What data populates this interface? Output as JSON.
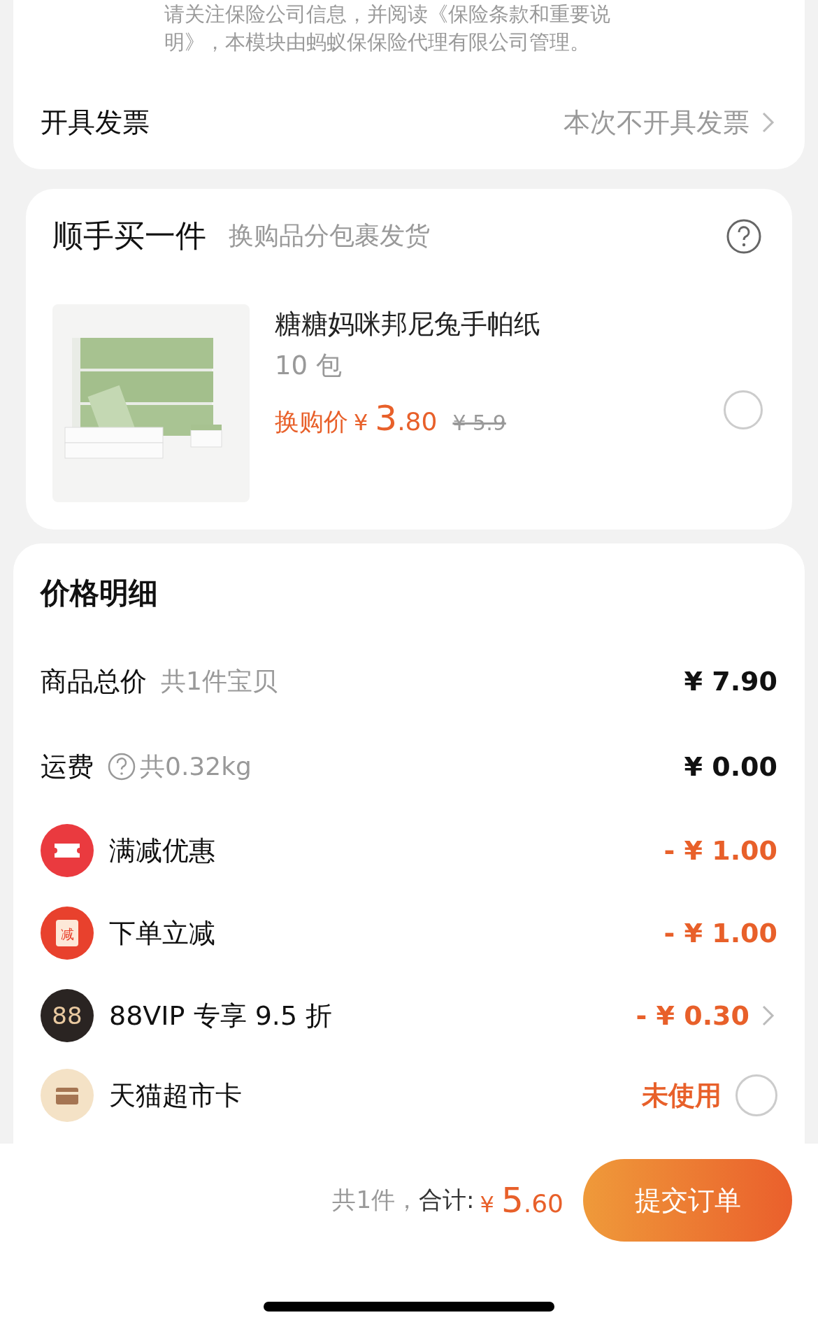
{
  "insurance_note": [
    "请关注保险公司信息，并阅读《保险条款和重要说",
    "明》，本模块由蚂蚁保保险代理有限公司管理。"
  ],
  "invoice": {
    "label": "开具发票",
    "value": "本次不开具发票"
  },
  "add_on": {
    "title": "顺手买一件",
    "subtitle": "换购品分包裹发货",
    "product": {
      "name": "糖糖妈咪邦尼兔手帕纸",
      "spec": "10 包",
      "price_label": "换购价",
      "currency": "¥",
      "price_int": "3",
      "price_dec": ".80",
      "original_price": "¥ 5.9",
      "selected": false
    }
  },
  "price_details": {
    "title": "价格明细",
    "rows": [
      {
        "kind": "plain",
        "label": "商品总价",
        "note": "共1件宝贝",
        "amount": "¥ 7.90",
        "discount": false,
        "chevron": false
      },
      {
        "kind": "shipping",
        "label": "运费",
        "note": "共0.32kg",
        "amount": "¥ 0.00",
        "discount": false,
        "chevron": false
      },
      {
        "kind": "ticket",
        "label": "满减优惠",
        "amount": "- ¥ 1.00",
        "discount": true,
        "chevron": false
      },
      {
        "kind": "envelope",
        "badge": "减",
        "label": "下单立减",
        "amount": "- ¥ 1.00",
        "discount": true,
        "chevron": false
      },
      {
        "kind": "vip",
        "badge": "88",
        "label": "88VIP 专享 9.5 折",
        "amount": "- ¥ 0.30",
        "discount": true,
        "chevron": true
      },
      {
        "kind": "card",
        "label": "天猫超市卡",
        "amount": "未使用",
        "discount": true,
        "chevron": false,
        "selected": false
      }
    ]
  },
  "footer": {
    "count": "共1件，",
    "total_label": "合计:",
    "currency": "¥",
    "total_int": "5",
    "total_dec": ".60",
    "submit": "提交订单"
  }
}
